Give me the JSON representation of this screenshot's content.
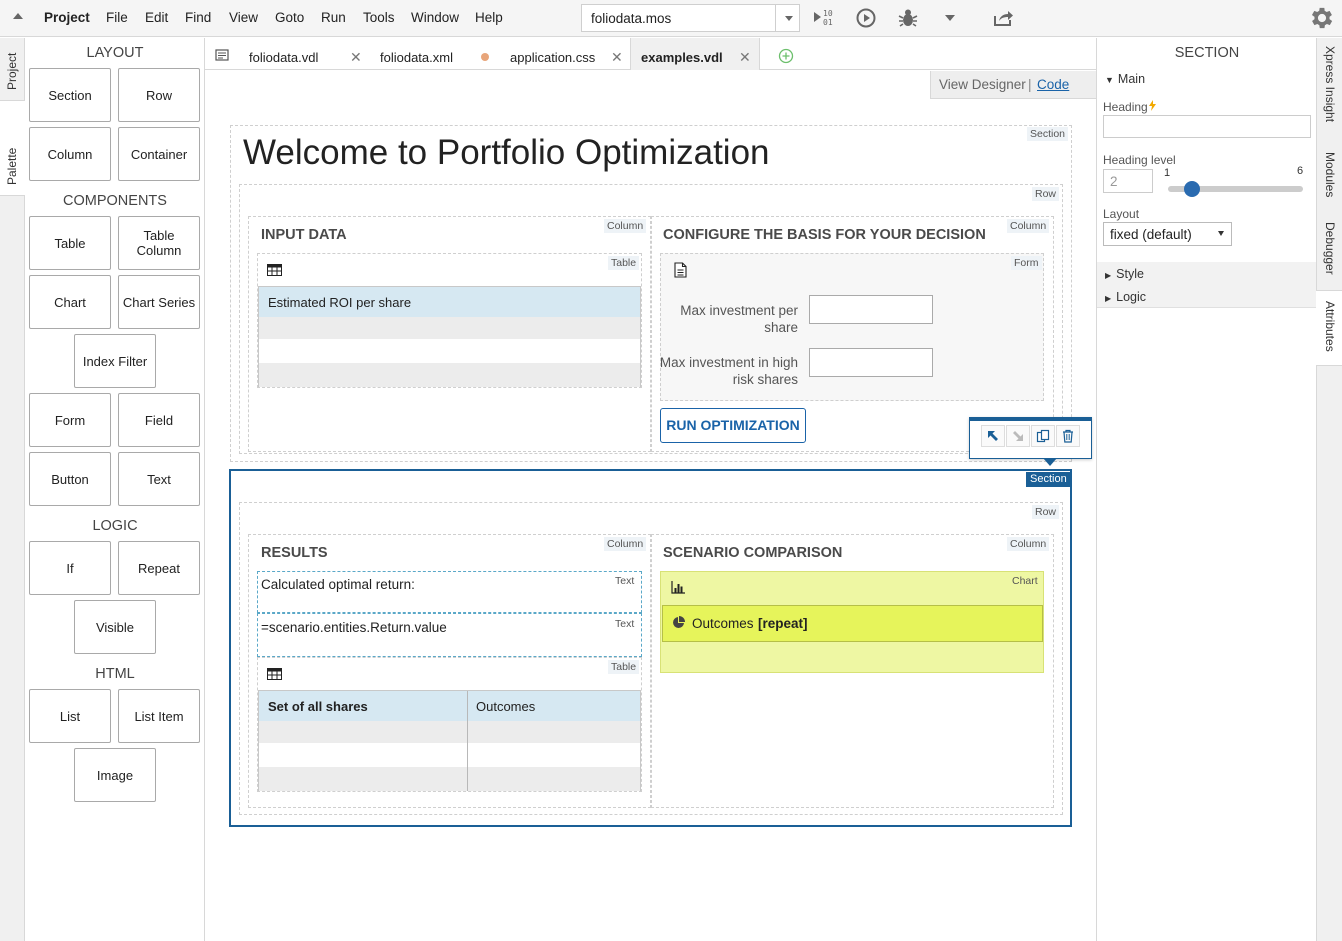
{
  "menubar": {
    "items": [
      "Project",
      "File",
      "Edit",
      "Find",
      "View",
      "Goto",
      "Run",
      "Tools",
      "Window",
      "Help"
    ],
    "file_select": "foliodata.mos"
  },
  "left_tabs": {
    "project": "Project",
    "palette": "Palette"
  },
  "palette": {
    "layout_title": "LAYOUT",
    "layout": [
      "Section",
      "Row",
      "Column",
      "Container"
    ],
    "components_title": "COMPONENTS",
    "components": [
      "Table",
      "Table Column",
      "Chart",
      "Chart Series",
      "Index Filter",
      "Form",
      "Field",
      "Button",
      "Text"
    ],
    "logic_title": "LOGIC",
    "logic": [
      "If",
      "Repeat",
      "Visible"
    ],
    "html_title": "HTML",
    "html": [
      "List",
      "List Item",
      "Image"
    ]
  },
  "tabs": [
    {
      "label": "foliodata.vdl"
    },
    {
      "label": "foliodata.xml"
    },
    {
      "label": "application.css"
    },
    {
      "label": "examples.vdl"
    }
  ],
  "view": {
    "designer": "View Designer",
    "sep": "|",
    "code": "Code"
  },
  "tags": {
    "section": "Section",
    "row": "Row",
    "column": "Column",
    "table": "Table",
    "form": "Form",
    "text": "Text",
    "chart": "Chart"
  },
  "section1": {
    "title": "Welcome to Portfolio Optimization",
    "input_data": "INPUT DATA",
    "roi_header": "Estimated ROI per share",
    "configure": "CONFIGURE THE BASIS FOR YOUR DECISION",
    "field1": "Max investment per share",
    "field2": "Max investment in high risk shares",
    "run": "RUN OPTIMIZATION"
  },
  "section2": {
    "results": "RESULTS",
    "text1": "Calculated optimal return:",
    "text2": "=scenario.entities.Return.value",
    "col1": "Set of all shares",
    "col2": "Outcomes",
    "scenario": "SCENARIO COMPARISON",
    "series": "Outcomes",
    "repeat": "[repeat]"
  },
  "rpanel": {
    "title": "SECTION",
    "main": "Main",
    "heading_label": "Heading",
    "heading_level_label": "Heading level",
    "heading_level_value": "2",
    "slider_min": "1",
    "slider_max": "6",
    "layout_label": "Layout",
    "layout_value": "fixed (default)",
    "style": "Style",
    "logic": "Logic"
  },
  "right_tabs": [
    "Xpress Insight",
    "Modules",
    "Debugger",
    "Attributes"
  ],
  "colors": {
    "accent": "#1a5f96",
    "table_header": "#d6e8f2",
    "chart_bg": "#eef7a3",
    "series_bg": "#e6f45b"
  }
}
